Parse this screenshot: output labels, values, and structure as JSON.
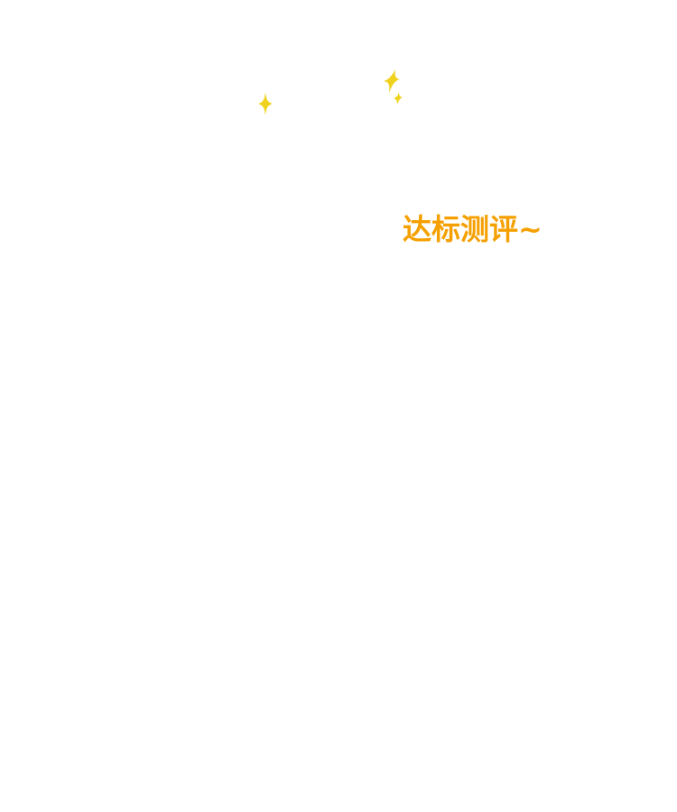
{
  "caption": {
    "text": "达标测评~",
    "color": "#f5a000"
  },
  "sparkles": {
    "color": "#f0d21e",
    "icon": "four-point-sparkle"
  }
}
